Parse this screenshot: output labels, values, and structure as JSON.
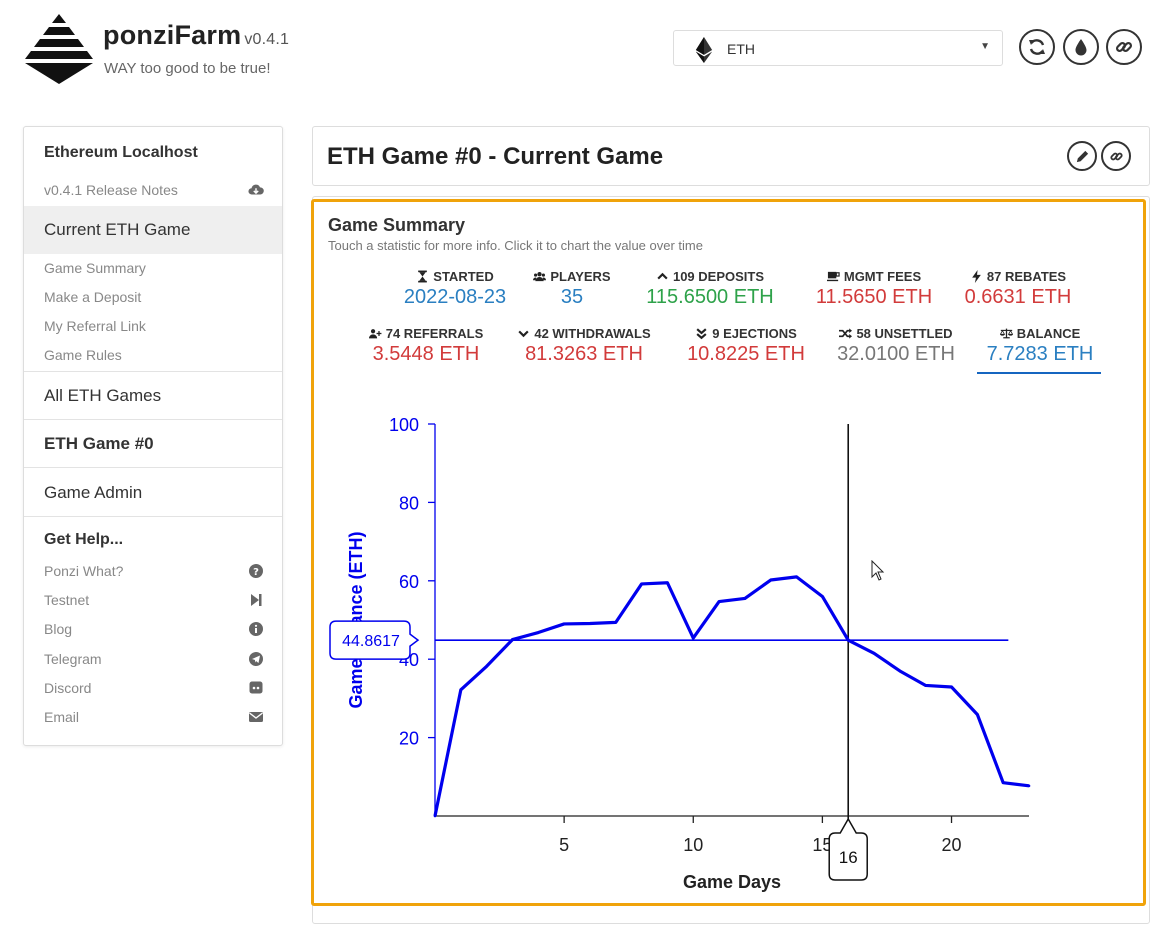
{
  "header": {
    "app_name": "ponziFarm",
    "version": "v0.4.1",
    "tagline": "WAY too good to be true!",
    "network_select": {
      "value": "ETH",
      "icon": "ethereum-icon"
    },
    "buttons": [
      {
        "name": "refresh-button",
        "icon": "refresh-icon"
      },
      {
        "name": "faucet-button",
        "icon": "droplet-icon"
      },
      {
        "name": "link-button",
        "icon": "link-icon"
      }
    ]
  },
  "sidebar": {
    "network_title": "Ethereum Localhost",
    "release_notes": "v0.4.1 Release Notes",
    "current_game": "Current ETH Game",
    "sub_items": [
      "Game Summary",
      "Make a Deposit",
      "My Referral Link",
      "Game Rules"
    ],
    "all_games": "All ETH Games",
    "game_n": "ETH Game #0",
    "game_admin": "Game Admin",
    "help_title": "Get Help...",
    "help_items": [
      {
        "label": "Ponzi What?",
        "icon": "question-circle-icon"
      },
      {
        "label": "Testnet",
        "icon": "step-forward-icon"
      },
      {
        "label": "Blog",
        "icon": "info-circle-icon"
      },
      {
        "label": "Telegram",
        "icon": "telegram-icon"
      },
      {
        "label": "Discord",
        "icon": "discord-icon"
      },
      {
        "label": "Email",
        "icon": "envelope-icon"
      }
    ]
  },
  "page": {
    "title": "ETH Game #0 - Current Game",
    "title_buttons": [
      {
        "name": "edit-button",
        "icon": "pencil-icon"
      },
      {
        "name": "share-link-button",
        "icon": "link-icon"
      }
    ]
  },
  "summary": {
    "title": "Game Summary",
    "subtitle": "Touch a statistic for more info. Click it to chart the value over time",
    "stats": [
      {
        "label": "STARTED",
        "value": "2022-08-23",
        "color": "#2a7fc1",
        "icon": "hourglass-icon"
      },
      {
        "label": "PLAYERS",
        "value": "35",
        "color": "#2a7fc1",
        "icon": "users-icon"
      },
      {
        "label": "109 DEPOSITS",
        "value": "115.6500 ETH",
        "color": "#2ea24a",
        "icon": "chevron-up-icon"
      },
      {
        "label": "MGMT FEES",
        "value": "11.5650 ETH",
        "color": "#d23b3b",
        "icon": "coffee-icon"
      },
      {
        "label": "87 REBATES",
        "value": "0.6631 ETH",
        "color": "#d23b3b",
        "icon": "bolt-icon"
      },
      {
        "label": "74 REFERRALS",
        "value": "3.5448 ETH",
        "color": "#d23b3b",
        "icon": "user-plus-icon"
      },
      {
        "label": "42 WITHDRAWALS",
        "value": "81.3263 ETH",
        "color": "#d23b3b",
        "icon": "chevron-down-icon"
      },
      {
        "label": "9 EJECTIONS",
        "value": "10.8225 ETH",
        "color": "#d23b3b",
        "icon": "double-chevron-down-icon"
      },
      {
        "label": "58 UNSETTLED",
        "value": "32.0100 ETH",
        "color": "#777777",
        "icon": "random-icon"
      },
      {
        "label": "BALANCE",
        "value": "7.7283 ETH",
        "color": "#2a7fc1",
        "icon": "balance-scale-icon",
        "selected": true
      }
    ]
  },
  "chart_data": {
    "type": "line",
    "xlabel": "Game Days",
    "ylabel": "Game Balance (ETH)",
    "xlim": [
      0,
      23
    ],
    "ylim": [
      0,
      100
    ],
    "x_ticks": [
      5,
      10,
      15,
      20
    ],
    "y_ticks": [
      20,
      40,
      60,
      80,
      100
    ],
    "series": [
      {
        "color": "#0000ee",
        "x": [
          0,
          1,
          2,
          3,
          4,
          5,
          6,
          7,
          8,
          9,
          10,
          11,
          12,
          13,
          14,
          15,
          16,
          17,
          18,
          19,
          20,
          21,
          22,
          23
        ],
        "values": [
          0,
          32.2,
          38.2,
          45,
          46.8,
          49,
          49.1,
          49.4,
          59.2,
          59.5,
          45.4,
          54.7,
          55.5,
          60.2,
          61,
          56,
          44.86,
          41.5,
          37,
          33.3,
          32.9,
          25.9,
          8.5,
          7.7
        ]
      }
    ],
    "crosshair": {
      "x": 16,
      "y": 44.8617,
      "x_label": "16",
      "y_label": "44.8617"
    },
    "reference_line_end_x": 22.2
  }
}
